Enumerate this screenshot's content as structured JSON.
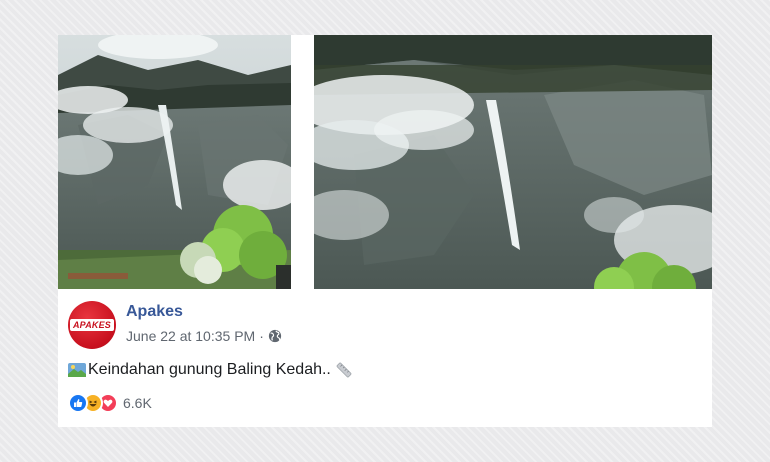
{
  "post": {
    "page_name": "Apakes",
    "avatar_text": "APAKES",
    "timestamp": "June 22 at 10:35 PM",
    "separator": "·",
    "privacy_icon": "globe-icon",
    "text": "Keindahan gunung Baling Kedah..",
    "text_emoji_before": "landscape-photo-icon",
    "text_emoji_after": "ruler-icon"
  },
  "reactions": {
    "types": [
      "like",
      "haha",
      "love"
    ],
    "count": "6.6K"
  },
  "colors": {
    "page_name": "#385898",
    "meta": "#606770",
    "brand_red": "#c8101e",
    "like_blue": "#1877f2"
  }
}
